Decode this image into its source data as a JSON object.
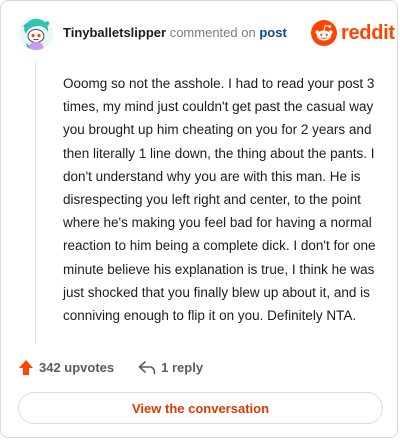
{
  "comment": {
    "username": "Tinyballetslipper",
    "commented_on_text": "commented on",
    "post_link_text": "post",
    "body": "Ooomg so not the asshole. I had to read your post 3 times, my mind just couldn't get past the casual way you brought up him cheating on you for 2 years and then literally 1 line down, the thing about the pants. I don't understand why you are with this man. He is disrespecting you left right and center, to the point where he's making you feel bad for having a normal reaction to him being a complete dick. I don't for one minute believe his explanation is true, I think he was just shocked that you finally blew up about it, and is conniving enough to flip it on you. Definitely NTA.",
    "upvotes_label": "342 upvotes",
    "replies_label": "1 reply"
  },
  "brand": {
    "logo_text": "reddit",
    "logo_icon": "reddit-alien-icon",
    "accent_color": "#ff4500"
  },
  "cta": {
    "label": "View the conversation"
  },
  "icons": {
    "avatar": "snoo-avatar-icon",
    "upvote": "upvote-arrow-icon",
    "reply": "reply-arrow-icon"
  }
}
